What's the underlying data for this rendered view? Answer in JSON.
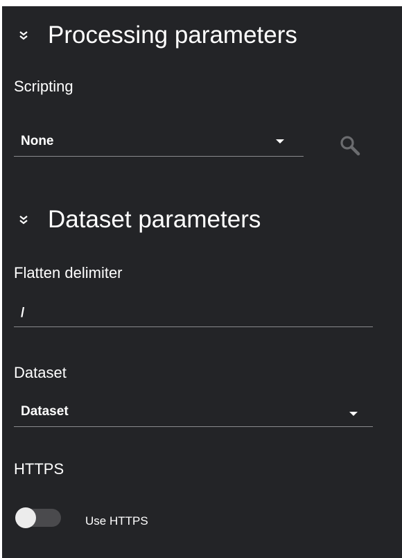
{
  "processing": {
    "title": "Processing parameters",
    "scripting_label": "Scripting",
    "scripting_value": "None"
  },
  "dataset_section": {
    "title": "Dataset parameters",
    "flatten_label": "Flatten delimiter",
    "flatten_value": "/",
    "dataset_label": "Dataset",
    "dataset_value": "Dataset"
  },
  "https": {
    "label": "HTTPS",
    "toggle_label": "Use HTTPS",
    "enabled": false
  },
  "colors": {
    "panel_background": "#232427",
    "text": "#ffffff",
    "divider": "#8a8b8e",
    "search_icon": "#6b6c6f"
  },
  "icons": [
    "chevron-double-down-icon",
    "search-icon",
    "dropdown-caret-icon"
  ]
}
